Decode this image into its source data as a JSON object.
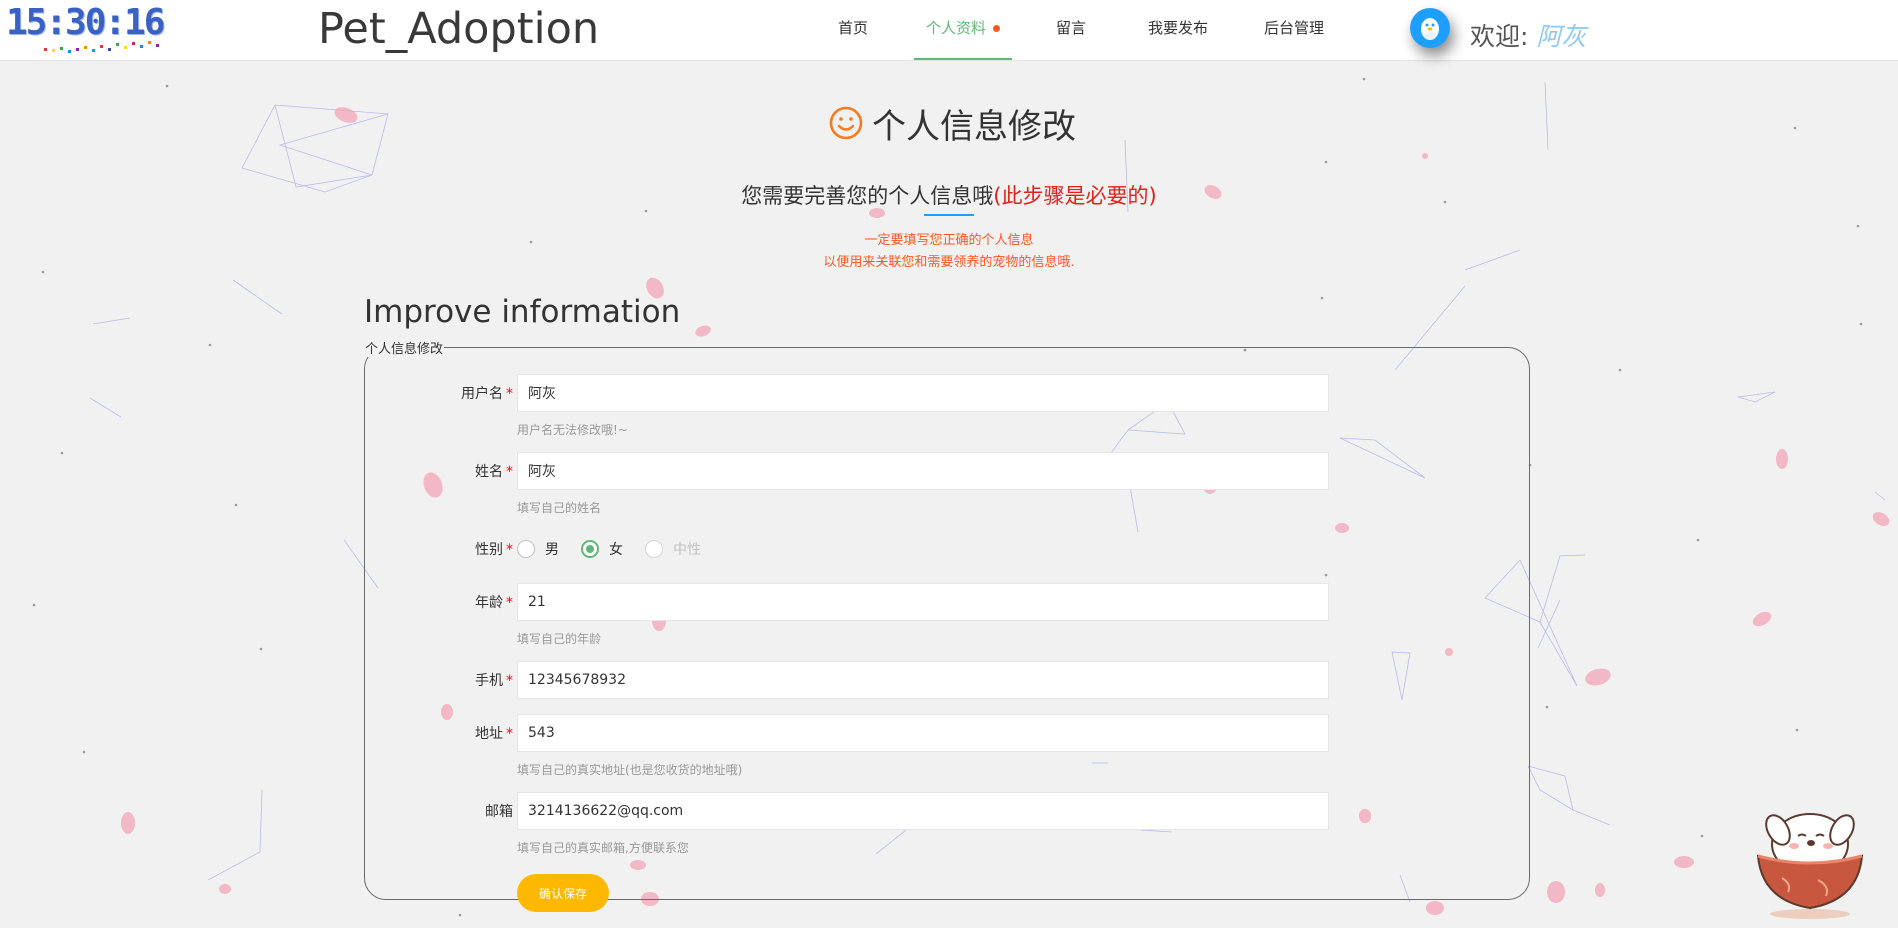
{
  "header": {
    "clock": "15:30:16",
    "brand": "Pet_Adoption",
    "nav": [
      {
        "label": "首页",
        "active": false
      },
      {
        "label": "个人资料",
        "active": true,
        "has_dot": true
      },
      {
        "label": "留言",
        "active": false
      },
      {
        "label": "我要发布",
        "active": false
      },
      {
        "label": "后台管理",
        "active": false
      }
    ],
    "avatar_icon": "qq-penguin-icon",
    "welcome_label": "欢迎:",
    "username": "阿灰"
  },
  "intro": {
    "title_icon": "smile-icon",
    "title": "个人信息修改",
    "subtitle": "您需要完善您的个人信息哦",
    "subtitle_required": "(此步骤是必要的)",
    "note_line1": "一定要填写您正确的个人信息",
    "note_line2": "以便用来关联您和需要领养的宠物的信息哦."
  },
  "form": {
    "section_title": "Improve information",
    "legend": "个人信息修改",
    "fields": {
      "username": {
        "label": "用户名",
        "required": "*",
        "value": "阿灰",
        "hint": "用户名无法修改哦!~"
      },
      "name": {
        "label": "姓名",
        "required": "*",
        "value": "阿灰",
        "hint": "填写自己的姓名"
      },
      "gender": {
        "label": "性别",
        "required": "*",
        "options": [
          "男",
          "女",
          "中性"
        ],
        "selected": "女"
      },
      "age": {
        "label": "年龄",
        "required": "*",
        "value": "21",
        "hint": "填写自己的年龄"
      },
      "phone": {
        "label": "手机",
        "required": "*",
        "value": "12345678932"
      },
      "address": {
        "label": "地址",
        "required": "*",
        "value": "543",
        "hint": "填写自己的真实地址(也是您收货的地址哦)"
      },
      "email": {
        "label": "邮箱",
        "value": "3214136622@qq.com",
        "hint": "填写自己的真实邮箱,方便联系您"
      }
    },
    "save_label": "确认保存"
  },
  "colors": {
    "nav_active": "#5fb878",
    "required": "#e0211b",
    "note": "#ff5722",
    "save_button": "#ffb800",
    "avatar": "#1e9fff"
  }
}
